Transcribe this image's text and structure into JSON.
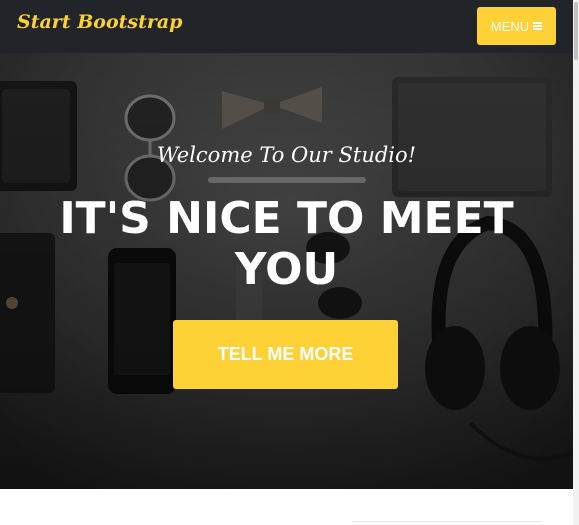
{
  "navbar": {
    "brand": "Start Bootstrap",
    "menu_label": "MENU",
    "menu_icon": "bars-icon"
  },
  "hero": {
    "subheading": "Welcome To Our Studio!",
    "heading": "It's Nice To Meet You",
    "cta_label": "Tell Me More"
  },
  "colors": {
    "accent": "#fed136",
    "navbar_bg": "#212529",
    "text_light": "#ffffff"
  }
}
